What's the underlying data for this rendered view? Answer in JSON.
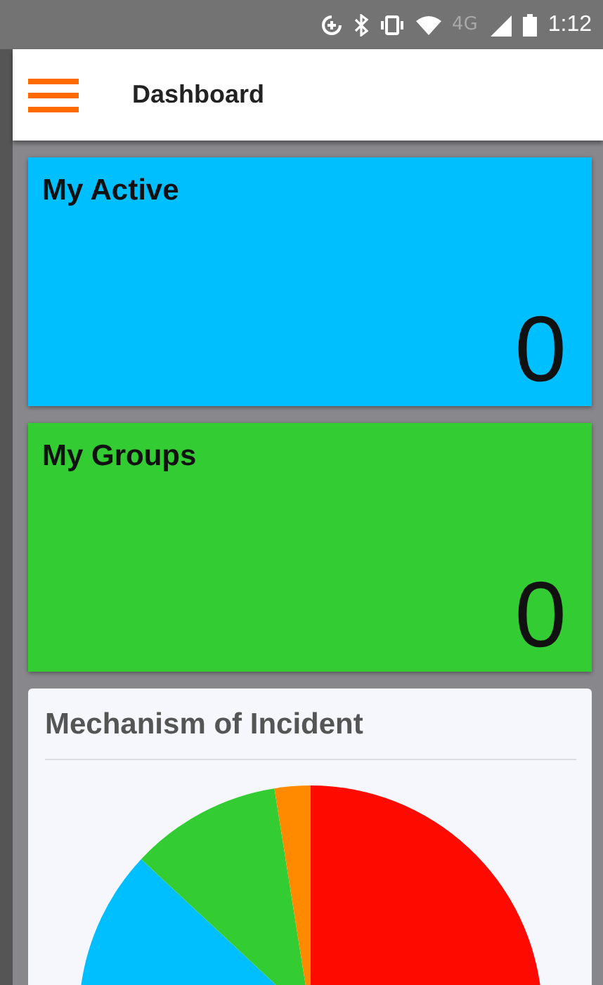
{
  "status_bar": {
    "network": "4G",
    "time": "1:12"
  },
  "app_bar": {
    "title": "Dashboard"
  },
  "cards": [
    {
      "title": "My Active",
      "value": "0",
      "color": "#00bfff"
    },
    {
      "title": "My Groups",
      "value": "0",
      "color": "#33cc33"
    }
  ],
  "chart_panel": {
    "title": "Mechanism of Incident"
  }
}
